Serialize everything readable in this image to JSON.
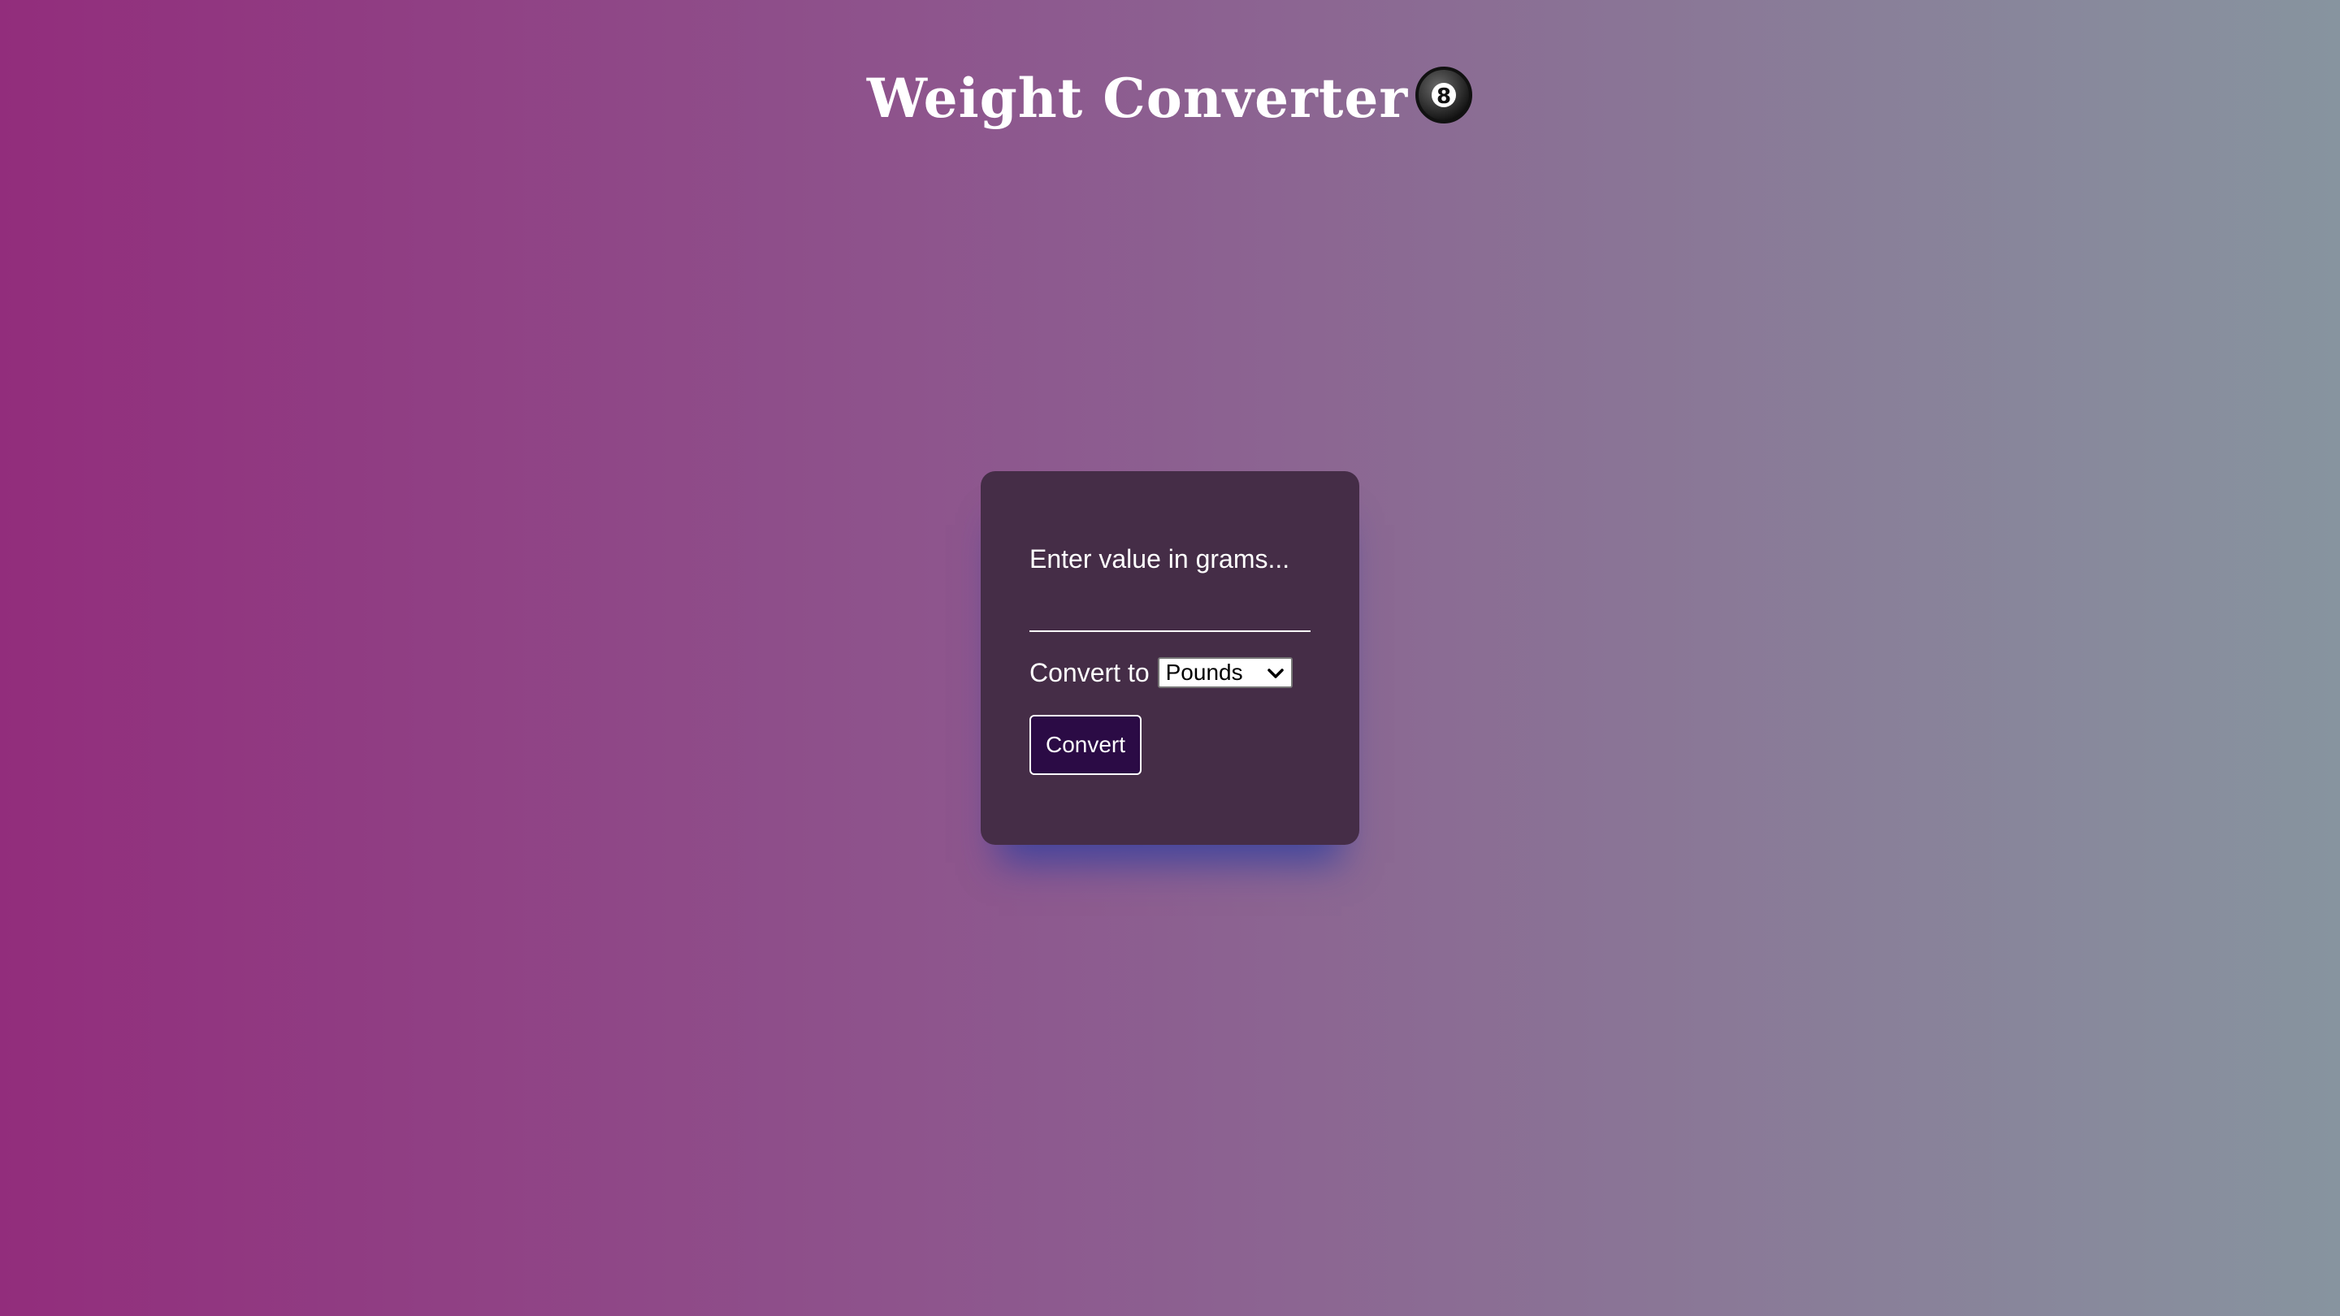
{
  "header": {
    "title": "Weight Converter",
    "title_icon": "8-ball-icon",
    "ball_number": "8"
  },
  "form": {
    "value_label": "Enter value in grams...",
    "value_input": "",
    "convert_to_label": "Convert to",
    "unit_selected": "Pounds",
    "convert_button_label": "Convert"
  },
  "colors": {
    "gradient_start": "#922d7c",
    "gradient_end": "#87949f",
    "card_background": "#452d47",
    "button_background": "#2b0b45",
    "card_shadow": "#283ca0"
  }
}
